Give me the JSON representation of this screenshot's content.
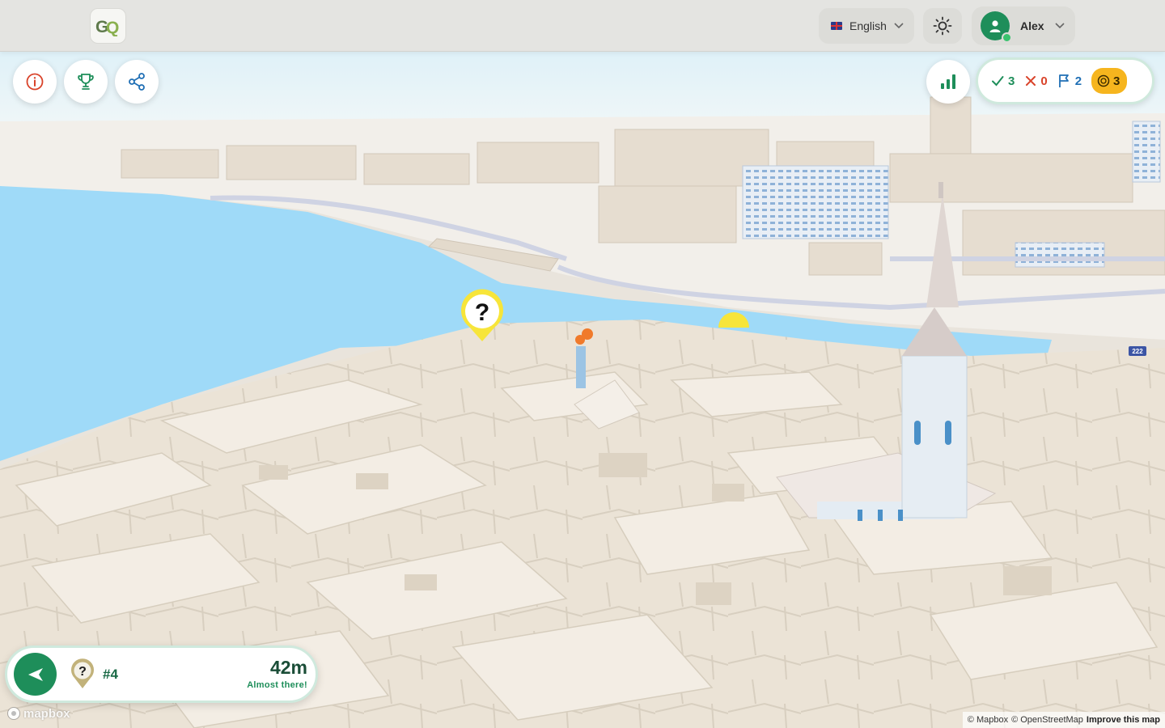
{
  "header": {
    "language": {
      "label": "English",
      "flag": "uk-flag"
    },
    "user": {
      "name": "Alex",
      "status": "online"
    }
  },
  "toolbar": {
    "buttons": [
      {
        "icon": "info-icon"
      },
      {
        "icon": "trophy-icon"
      },
      {
        "icon": "share-icon"
      }
    ],
    "stats_icon": "bar-chart-icon"
  },
  "score": {
    "correct": "3",
    "wrong": "0",
    "flags": "2",
    "coins": "3"
  },
  "map": {
    "marker_question": "?",
    "road_shield": "222",
    "water_color": "#9fdaf8",
    "building_color": "#ece4d8",
    "marker_color": "#f7e53a"
  },
  "navigation": {
    "target_number": "#4",
    "target_icon": "?",
    "distance": "42m",
    "message": "Almost there!"
  },
  "attribution": {
    "logo": "mapbox",
    "mapbox": "© Mapbox",
    "osm": "© OpenStreetMap",
    "improve": "Improve this map"
  },
  "colors": {
    "brand_green": "#1e8e5a",
    "correct": "#1e8e5a",
    "wrong": "#d9432a",
    "flag": "#1f6fb5",
    "coin": "#f6b51e"
  }
}
